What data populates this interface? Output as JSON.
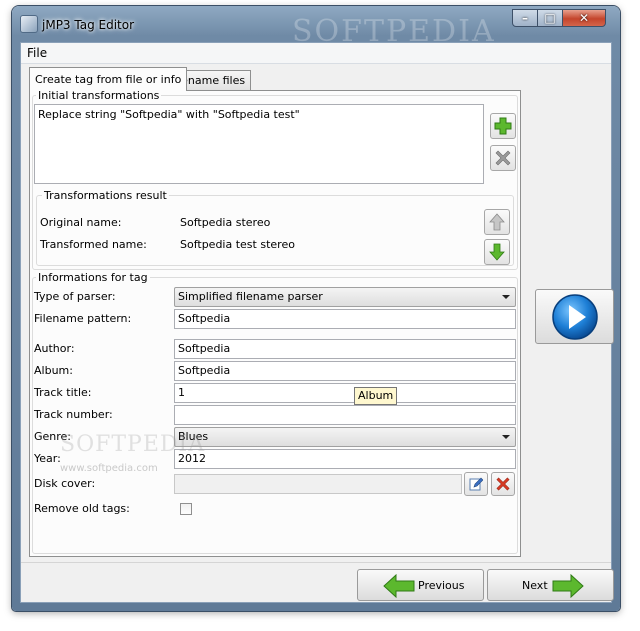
{
  "window": {
    "title": "jMP3 Tag Editor",
    "watermark": "SOFTPEDIA"
  },
  "menu": {
    "file": "File"
  },
  "tabs": [
    {
      "label": "Create tag from file or info",
      "active": true
    },
    {
      "label": "Rename files",
      "active": false
    }
  ],
  "initial": {
    "title": "Initial transformations",
    "items": [
      "Replace string \"Softpedia\" with \"Softpedia test\""
    ]
  },
  "result": {
    "title": "Transformations result",
    "original_label": "Original name:",
    "original_value": "Softpedia stereo",
    "transformed_label": "Transformed name:",
    "transformed_value": "Softpedia test stereo"
  },
  "info": {
    "title": "Informations for tag",
    "parser_label": "Type of parser:",
    "parser_value": "Simplified filename parser",
    "pattern_label": "Filename pattern:",
    "pattern_value": "Softpedia",
    "author_label": "Author:",
    "author_value": "Softpedia",
    "album_label": "Album:",
    "album_value": "Softpedia",
    "track_title_label": "Track title:",
    "track_title_value": "1",
    "track_number_label": "Track number:",
    "track_number_value": "",
    "genre_label": "Genre:",
    "genre_value": "Blues",
    "year_label": "Year:",
    "year_value": "2012",
    "disk_cover_label": "Disk cover:",
    "disk_cover_value": "",
    "remove_old_label": "Remove old tags:",
    "remove_old_checked": false
  },
  "tooltip": "Album",
  "nav": {
    "previous": "Previous",
    "next": "Next"
  },
  "watermark_overlay": {
    "brand": "SOFTPEDIA",
    "url": "www.softpedia.com"
  },
  "colors": {
    "accent_blue": "#1e7fd6",
    "green_arrow": "#5cb82e",
    "remove_red": "#d83a24"
  }
}
